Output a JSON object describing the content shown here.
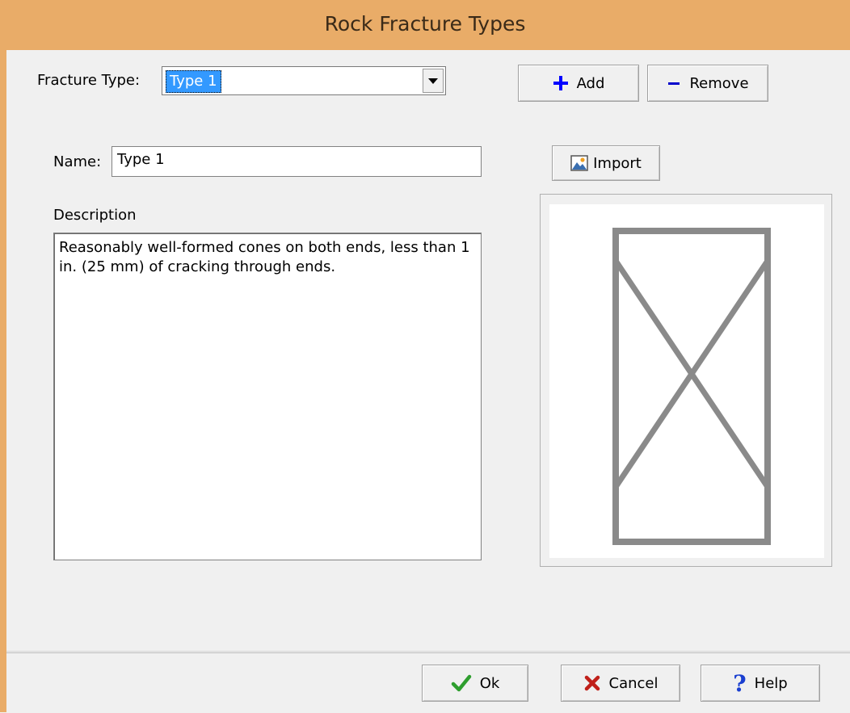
{
  "window": {
    "title": "Rock Fracture Types"
  },
  "fracture_type": {
    "label": "Fracture Type:",
    "selected": "Type 1"
  },
  "toolbar": {
    "add_label": "Add",
    "remove_label": "Remove",
    "import_label": "Import"
  },
  "form": {
    "name_label": "Name:",
    "name_value": "Type 1",
    "description_label": "Description",
    "description_value": "Reasonably well-formed cones on both ends, less than 1 in. (25 mm) of cracking through ends."
  },
  "footer": {
    "ok_label": "Ok",
    "cancel_label": "Cancel",
    "help_label": "Help"
  },
  "icons": {
    "add": "plus-icon",
    "remove": "minus-icon",
    "import": "image-icon",
    "ok": "checkmark-icon",
    "cancel": "x-icon",
    "help": "question-icon"
  },
  "colors": {
    "title_bar": "#e9ac68",
    "selection": "#3399ff",
    "add_plus": "#0000ff",
    "ok_check": "#2e9e2e",
    "cancel_x": "#c0201a",
    "help_q": "#1a3fd0"
  }
}
